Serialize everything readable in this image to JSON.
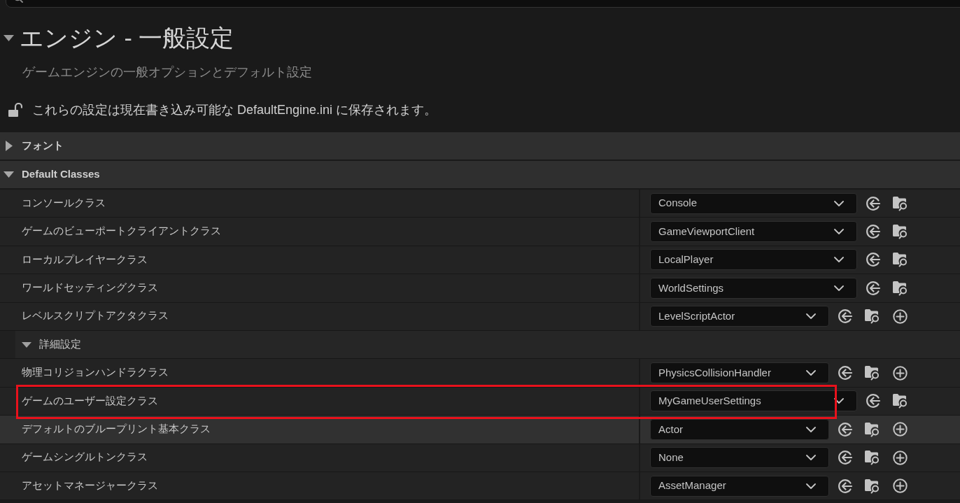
{
  "page": {
    "title": "エンジン - 一般設定",
    "expanded": true,
    "description": "ゲームエンジンの一般オプションとデフォルト設定",
    "locked": false,
    "save_notice": "これらの設定は現在書き込み可能な DefaultEngine.ini に保存されます。"
  },
  "categories": [
    {
      "name": "フォント",
      "expanded": false
    },
    {
      "name": "Default Classes",
      "expanded": true,
      "properties": [
        {
          "kind": "property",
          "label": "コンソールクラス",
          "value": "Console",
          "add_button": false,
          "hovered": false,
          "highlighted": false
        },
        {
          "kind": "property",
          "label": "ゲームのビューポートクライアントクラス",
          "value": "GameViewportClient",
          "add_button": false,
          "hovered": false,
          "highlighted": false
        },
        {
          "kind": "property",
          "label": "ローカルプレイヤークラス",
          "value": "LocalPlayer",
          "add_button": false,
          "hovered": false,
          "highlighted": false
        },
        {
          "kind": "property",
          "label": "ワールドセッティングクラス",
          "value": "WorldSettings",
          "add_button": false,
          "hovered": false,
          "highlighted": false
        },
        {
          "kind": "property",
          "label": "レベルスクリプトアクタクラス",
          "value": "LevelScriptActor",
          "add_button": true,
          "hovered": false,
          "highlighted": false
        },
        {
          "kind": "group",
          "label": "詳細設定",
          "expanded": true,
          "children": [
            {
              "kind": "property",
              "label": "物理コリジョンハンドラクラス",
              "value": "PhysicsCollisionHandler",
              "add_button": true,
              "hovered": false,
              "highlighted": false
            },
            {
              "kind": "property",
              "label": "ゲームのユーザー設定クラス",
              "value": "MyGameUserSettings",
              "add_button": false,
              "hovered": false,
              "highlighted": true
            },
            {
              "kind": "property",
              "label": "デフォルトのブループリント基本クラス",
              "value": "Actor",
              "add_button": true,
              "hovered": true,
              "highlighted": false
            },
            {
              "kind": "property",
              "label": "ゲームシングルトンクラス",
              "value": "None",
              "add_button": true,
              "hovered": false,
              "highlighted": false
            },
            {
              "kind": "property",
              "label": "アセットマネージャークラス",
              "value": "AssetManager",
              "add_button": true,
              "hovered": false,
              "highlighted": false
            }
          ]
        }
      ]
    }
  ]
}
